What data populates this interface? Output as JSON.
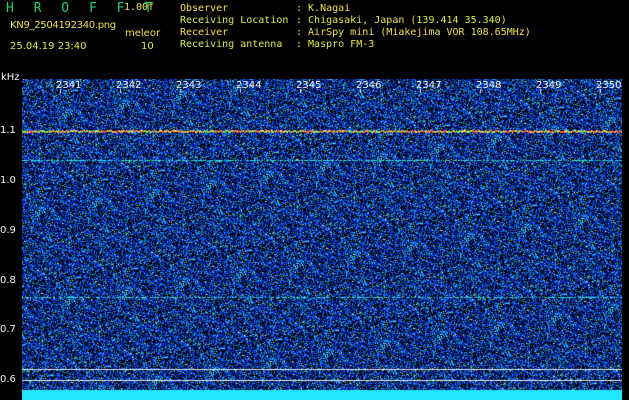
{
  "header": {
    "app_title": "H R O F F T",
    "version": "1.00f",
    "file_name": "KN9_2504192340.png",
    "datetime": "25.04.19 23:40",
    "unit_label": "meleor",
    "unit_value": "10"
  },
  "metadata": [
    {
      "key": "Observer",
      "value": ": K.Nagai"
    },
    {
      "key": "Receiving Location",
      "value": ": Chigasaki, Japan (139.414 35.340)"
    },
    {
      "key": "Receiver",
      "value": ": AirSpy mini (Miakejima VOR 108.65MHz)"
    },
    {
      "key": "Receiving antenna",
      "value": ": Maspro FM-3"
    }
  ],
  "axes": {
    "y_unit": "kHz",
    "y_ticks": [
      "1.1",
      "1.0",
      "0.9",
      "0.8",
      "0.7",
      "0.6"
    ],
    "x_ticks": [
      "2341",
      "2342",
      "2343",
      "2344",
      "2345",
      "2346",
      "2347",
      "2348",
      "2349",
      "2350"
    ]
  },
  "colors": {
    "background": "#000000",
    "noise_blue": "#1030d0",
    "carrier": "#ff5050"
  }
}
